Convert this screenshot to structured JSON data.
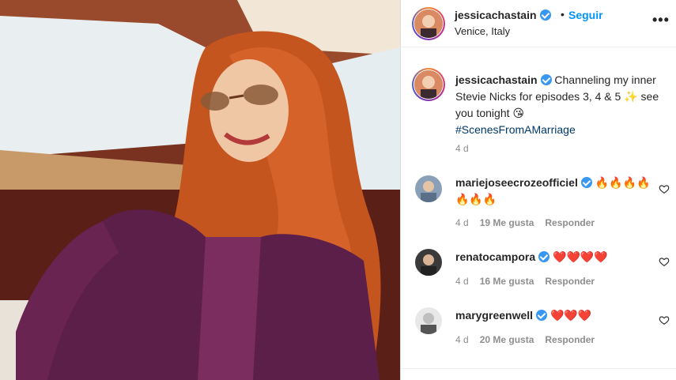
{
  "header": {
    "username": "jessicachastain",
    "separator": "•",
    "follow_label": "Seguir",
    "location": "Venice, Italy",
    "more_label": "•••"
  },
  "caption": {
    "username": "jessicachastain",
    "text": "Channeling my inner Stevie Nicks for episodes 3, 4 & 5 ✨ see you tonight 😘",
    "hashtag": "#ScenesFromAMarriage",
    "time": "4 d"
  },
  "comments": [
    {
      "username": "mariejoseecrozeofficiel",
      "text": "🔥🔥🔥🔥🔥🔥🔥",
      "time": "4 d",
      "likes": "19 Me gusta",
      "reply": "Responder"
    },
    {
      "username": "renatocampora",
      "text": "❤️❤️❤️❤️",
      "time": "4 d",
      "likes": "16 Me gusta",
      "reply": "Responder"
    },
    {
      "username": "marygreenwell",
      "text": "❤️❤️❤️",
      "time": "4 d",
      "likes": "20 Me gusta",
      "reply": "Responder"
    }
  ],
  "icons": {
    "verified": "verified-badge-icon",
    "heart": "heart-outline-icon",
    "more": "more-options-icon"
  },
  "colors": {
    "accent": "#0095f6",
    "hashtag": "#00376b",
    "verified": "#3897f0",
    "muted": "#8e8e8e"
  }
}
